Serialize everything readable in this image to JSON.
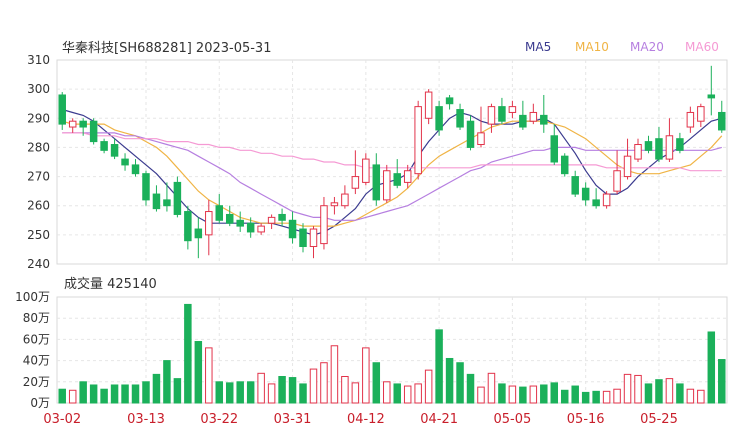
{
  "chart_data": {
    "type": "candlestick",
    "title": "华秦科技[SH688281] 2023-05-31",
    "legend": [
      {
        "label": "MA5",
        "color": "#3b3b8f"
      },
      {
        "label": "MA10",
        "color": "#f0b445"
      },
      {
        "label": "MA20",
        "color": "#b67fe0"
      },
      {
        "label": "MA60",
        "color": "#f59ad4"
      }
    ],
    "colors": {
      "up": "#e2334a",
      "down": "#1bb05a",
      "grid": "#e6e6e6",
      "axis_date": "#c81e2a"
    },
    "price_axis": {
      "min": 240,
      "max": 310,
      "ticks": [
        "310",
        "300",
        "290",
        "280",
        "270",
        "260",
        "250",
        "240"
      ]
    },
    "volume": {
      "label": "成交量 425140",
      "axis_max": 100,
      "ticks": [
        "100万",
        "80万",
        "60万",
        "40万",
        "20万",
        "0万"
      ]
    },
    "x_labels": [
      {
        "i": 0,
        "text": "03-02"
      },
      {
        "i": 8,
        "text": "03-13"
      },
      {
        "i": 15,
        "text": "03-22"
      },
      {
        "i": 22,
        "text": "03-31"
      },
      {
        "i": 29,
        "text": "04-12"
      },
      {
        "i": 36,
        "text": "04-21"
      },
      {
        "i": 43,
        "text": "05-05"
      },
      {
        "i": 50,
        "text": "05-16"
      },
      {
        "i": 57,
        "text": "05-25"
      }
    ],
    "ohlc": [
      [
        298,
        288,
        299,
        286
      ],
      [
        287,
        289,
        290,
        285
      ],
      [
        289,
        287,
        290,
        284
      ],
      [
        289,
        282,
        290,
        281
      ],
      [
        282,
        279,
        283,
        278
      ],
      [
        281,
        277,
        283,
        276
      ],
      [
        276,
        274,
        278,
        272
      ],
      [
        274,
        271,
        276,
        270
      ],
      [
        271,
        262,
        272,
        260
      ],
      [
        264,
        259,
        267,
        258
      ],
      [
        262,
        260,
        268,
        258
      ],
      [
        268,
        257,
        270,
        256
      ],
      [
        258,
        248,
        260,
        245
      ],
      [
        252,
        249,
        256,
        242
      ],
      [
        250,
        258,
        262,
        243
      ],
      [
        260,
        255,
        264,
        254
      ],
      [
        257,
        254,
        260,
        253
      ],
      [
        255,
        253,
        258,
        251
      ],
      [
        254,
        251,
        256,
        249
      ],
      [
        251,
        253,
        254,
        250
      ],
      [
        254,
        256,
        257,
        252
      ],
      [
        257,
        255,
        259,
        253
      ],
      [
        255,
        249,
        258,
        247
      ],
      [
        252,
        246,
        254,
        244
      ],
      [
        246,
        252,
        253,
        242
      ],
      [
        247,
        260,
        263,
        245
      ],
      [
        260,
        261,
        263,
        257
      ],
      [
        260,
        264,
        267,
        259
      ],
      [
        266,
        270,
        279,
        264
      ],
      [
        268,
        276,
        278,
        267
      ],
      [
        274,
        262,
        278,
        260
      ],
      [
        262,
        272,
        274,
        261
      ],
      [
        271,
        267,
        276,
        266
      ],
      [
        268,
        272,
        274,
        266
      ],
      [
        271,
        294,
        296,
        269
      ],
      [
        290,
        299,
        300,
        288
      ],
      [
        294,
        286,
        296,
        284
      ],
      [
        297,
        295,
        298,
        293
      ],
      [
        293,
        287,
        295,
        286
      ],
      [
        289,
        280,
        291,
        279
      ],
      [
        281,
        285,
        294,
        280
      ],
      [
        288,
        294,
        295,
        285
      ],
      [
        294,
        289,
        297,
        288
      ],
      [
        292,
        294,
        296,
        290
      ],
      [
        291,
        287,
        296,
        286
      ],
      [
        289,
        292,
        295,
        288
      ],
      [
        291,
        288,
        298,
        285
      ],
      [
        284,
        275,
        288,
        274
      ],
      [
        277,
        271,
        278,
        270
      ],
      [
        270,
        264,
        272,
        263
      ],
      [
        266,
        262,
        268,
        260
      ],
      [
        262,
        260,
        266,
        259
      ],
      [
        260,
        264,
        265,
        259
      ],
      [
        265,
        272,
        279,
        264
      ],
      [
        270,
        277,
        283,
        269
      ],
      [
        276,
        281,
        283,
        275
      ],
      [
        282,
        279,
        284,
        278
      ],
      [
        283,
        276,
        287,
        275
      ],
      [
        276,
        284,
        290,
        275
      ],
      [
        283,
        279,
        285,
        278
      ],
      [
        287,
        292,
        294,
        285
      ],
      [
        289,
        294,
        295,
        287
      ],
      [
        298,
        297,
        308,
        291
      ],
      [
        292,
        286,
        296,
        285
      ]
    ],
    "volumes": [
      13,
      12,
      20,
      17,
      13,
      17,
      17,
      17,
      20,
      27,
      40,
      23,
      93,
      58,
      52,
      20,
      19,
      20,
      20,
      28,
      18,
      25,
      24,
      18,
      32,
      38,
      54,
      25,
      19,
      52,
      38,
      20,
      18,
      16,
      18,
      31,
      69,
      42,
      38,
      27,
      15,
      28,
      18,
      16,
      15,
      16,
      17,
      19,
      12,
      16,
      10,
      11,
      11,
      13,
      27,
      26,
      18,
      22,
      23,
      18,
      13,
      12,
      67,
      41
    ],
    "ma": {
      "MA5": [
        293,
        292,
        291,
        289,
        286,
        283,
        280,
        277,
        274,
        271,
        267,
        263,
        259,
        256,
        254,
        254,
        254,
        254,
        254,
        254,
        254,
        253,
        252,
        251,
        250,
        251,
        253,
        256,
        259,
        264,
        267,
        268,
        269,
        271,
        277,
        282,
        286,
        290,
        292,
        291,
        289,
        288,
        288,
        288,
        289,
        289,
        290,
        288,
        283,
        278,
        272,
        267,
        264,
        264,
        266,
        270,
        273,
        276,
        278,
        280,
        283,
        286,
        289,
        290
      ],
      "MA10": [
        289,
        288,
        288,
        288,
        288,
        286,
        285,
        284,
        282,
        280,
        277,
        273,
        269,
        265,
        262,
        260,
        258,
        256,
        255,
        254,
        254,
        254,
        254,
        253,
        253,
        253,
        253,
        254,
        255,
        257,
        259,
        261,
        263,
        266,
        270,
        274,
        277,
        279,
        281,
        283,
        285,
        287,
        288,
        289,
        289,
        289,
        289,
        288,
        287,
        285,
        283,
        280,
        277,
        274,
        272,
        271,
        271,
        271,
        272,
        273,
        274,
        277,
        280,
        284
      ],
      "MA20": [
        285,
        285,
        285,
        285,
        285,
        285,
        284,
        284,
        283,
        282,
        281,
        280,
        279,
        277,
        275,
        273,
        271,
        268,
        266,
        264,
        262,
        260,
        258,
        257,
        256,
        256,
        255,
        255,
        255,
        256,
        257,
        258,
        259,
        260,
        262,
        264,
        266,
        268,
        270,
        272,
        273,
        275,
        276,
        277,
        278,
        279,
        279,
        280,
        280,
        280,
        279,
        279,
        279,
        279,
        279,
        279,
        279,
        279,
        279,
        279,
        279,
        279,
        279,
        280
      ],
      "MA60": [
        285,
        285,
        285,
        284,
        284,
        284,
        283,
        283,
        283,
        283,
        282,
        282,
        282,
        281,
        281,
        280,
        280,
        279,
        279,
        278,
        278,
        277,
        277,
        276,
        276,
        275,
        275,
        274,
        274,
        273,
        273,
        273,
        273,
        273,
        273,
        273,
        273,
        273,
        273,
        273,
        274,
        274,
        274,
        274,
        274,
        274,
        274,
        274,
        274,
        274,
        274,
        274,
        273,
        273,
        273,
        273,
        273,
        273,
        273,
        273,
        272,
        272,
        272,
        272
      ]
    }
  }
}
